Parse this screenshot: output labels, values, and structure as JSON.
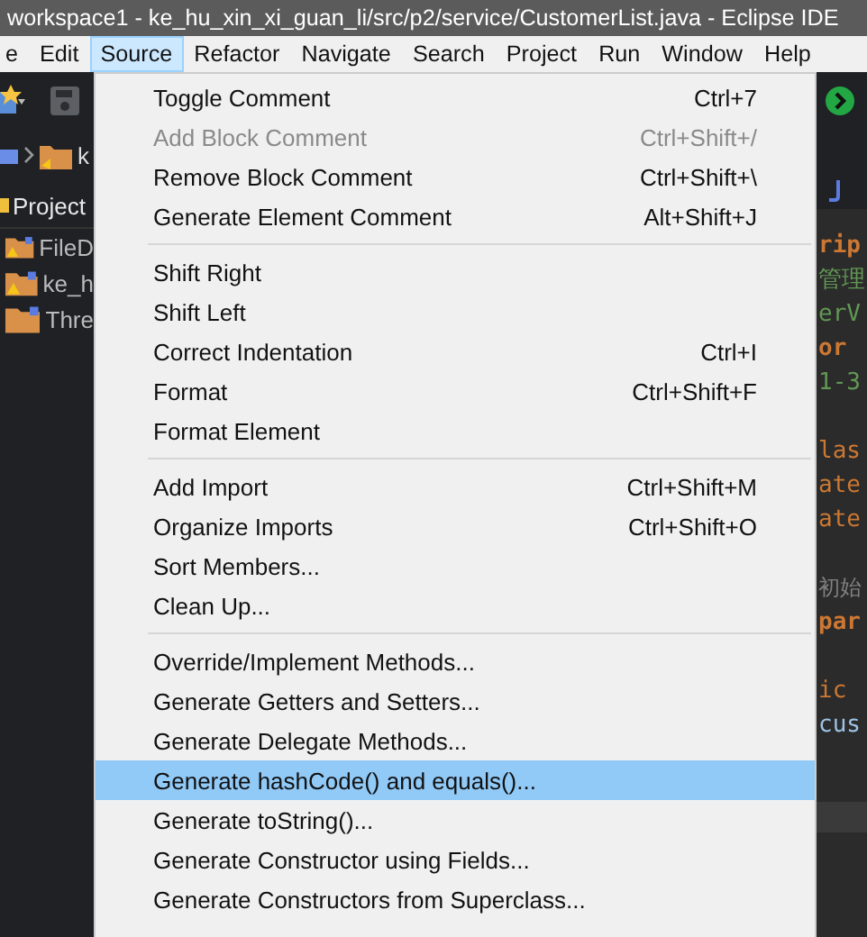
{
  "window": {
    "title": "workspace1 - ke_hu_xin_xi_guan_li/src/p2/service/CustomerList.java - Eclipse IDE"
  },
  "menubar": [
    {
      "label": "e",
      "selected": false
    },
    {
      "label": "Edit",
      "selected": false
    },
    {
      "label": "Source",
      "selected": true
    },
    {
      "label": "Refactor",
      "selected": false
    },
    {
      "label": "Navigate",
      "selected": false
    },
    {
      "label": "Search",
      "selected": false
    },
    {
      "label": "Project",
      "selected": false
    },
    {
      "label": "Run",
      "selected": false
    },
    {
      "label": "Window",
      "selected": false
    },
    {
      "label": "Help",
      "selected": false
    }
  ],
  "breadcrumb": {
    "label": "k"
  },
  "project_explorer": {
    "title": "Project",
    "items": [
      {
        "label": "FileD",
        "warning": true
      },
      {
        "label": "ke_h",
        "warning": true
      },
      {
        "label": "Thre",
        "warning": false
      }
    ]
  },
  "editor": {
    "blocks": [
      [
        {
          "text": "rip",
          "kind": "keyword"
        },
        {
          "text": "管理",
          "kind": "comment"
        },
        {
          "text": "erV",
          "kind": "comment"
        },
        {
          "text": "or",
          "kind": "keyword"
        },
        {
          "text": "1-3",
          "kind": "comment"
        }
      ],
      [
        {
          "text": "las",
          "kind": "plain_keyword"
        },
        {
          "text": "ate",
          "kind": "plain_keyword"
        },
        {
          "text": "ate",
          "kind": "plain_keyword"
        }
      ],
      [
        {
          "text": "初始",
          "kind": "doc"
        },
        {
          "text": "par",
          "kind": "keyword"
        }
      ],
      [
        {
          "text": "ic",
          "kind": "plain_keyword"
        },
        {
          "text": "cus",
          "kind": "field"
        }
      ]
    ]
  },
  "source_menu": {
    "groups": [
      [
        {
          "label": "Toggle Comment",
          "shortcut": "Ctrl+7",
          "disabled": false,
          "selected": false
        },
        {
          "label": "Add Block Comment",
          "shortcut": "Ctrl+Shift+/",
          "disabled": true,
          "selected": false
        },
        {
          "label": "Remove Block Comment",
          "shortcut": "Ctrl+Shift+\\",
          "disabled": false,
          "selected": false
        },
        {
          "label": "Generate Element Comment",
          "shortcut": "Alt+Shift+J",
          "disabled": false,
          "selected": false
        }
      ],
      [
        {
          "label": "Shift Right",
          "disabled": false,
          "selected": false
        },
        {
          "label": "Shift Left",
          "disabled": false,
          "selected": false
        },
        {
          "label": "Correct Indentation",
          "shortcut": "Ctrl+I",
          "disabled": false,
          "selected": false
        },
        {
          "label": "Format",
          "shortcut": "Ctrl+Shift+F",
          "disabled": false,
          "selected": false
        },
        {
          "label": "Format Element",
          "disabled": false,
          "selected": false
        }
      ],
      [
        {
          "label": "Add Import",
          "shortcut": "Ctrl+Shift+M",
          "disabled": false,
          "selected": false
        },
        {
          "label": "Organize Imports",
          "shortcut": "Ctrl+Shift+O",
          "disabled": false,
          "selected": false
        },
        {
          "label": "Sort Members...",
          "disabled": false,
          "selected": false
        },
        {
          "label": "Clean Up...",
          "disabled": false,
          "selected": false
        }
      ],
      [
        {
          "label": "Override/Implement Methods...",
          "disabled": false,
          "selected": false
        },
        {
          "label": "Generate Getters and Setters...",
          "disabled": false,
          "selected": false
        },
        {
          "label": "Generate Delegate Methods...",
          "disabled": false,
          "selected": false
        },
        {
          "label": "Generate hashCode() and equals()...",
          "disabled": false,
          "selected": true
        },
        {
          "label": "Generate toString()...",
          "disabled": false,
          "selected": false
        },
        {
          "label": "Generate Constructor using Fields...",
          "disabled": false,
          "selected": false
        },
        {
          "label": "Generate Constructors from Superclass...",
          "disabled": false,
          "selected": false
        }
      ]
    ]
  }
}
